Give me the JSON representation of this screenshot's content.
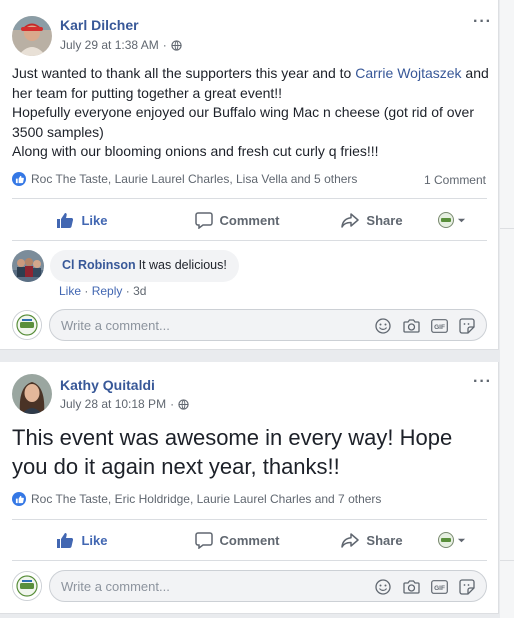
{
  "posts": [
    {
      "author": "Karl Dilcher",
      "timestamp": "July 29 at 1:38 AM",
      "dot": "·",
      "text_parts": {
        "p1": "Just wanted to thank all the supporters this year and to ",
        "mention": "Carrie Wojtaszek",
        "p2": " and her team for putting together a great event!!",
        "line2": "Hopefully everyone enjoyed our Buffalo wing Mac n cheese (got rid of over 3500 samples)",
        "line3": "Along with our blooming onions and fresh cut curly q fries!!!"
      },
      "reactions": "Roc The Taste, Laurie Laurel Charles, Lisa Vella and 5 others",
      "comment_count": "1 Comment",
      "comments": [
        {
          "name": "Cl Robinson",
          "text": "It was delicious!",
          "like": "Like",
          "reply": "Reply",
          "age": "3d"
        }
      ]
    },
    {
      "author": "Kathy Quitaldi",
      "timestamp": "July 28 at 10:18 PM",
      "dot": "·",
      "text": "This event was awesome in every way! Hope you do it again next year, thanks!!",
      "reactions": "Roc The Taste, Eric Holdridge, Laurie Laurel Charles and 7 others"
    }
  ],
  "actions": {
    "like": "Like",
    "comment": "Comment",
    "share": "Share"
  },
  "write_comment": {
    "placeholder": "Write a comment...",
    "gif_label": "GIF"
  },
  "comment_separator": "·",
  "icons": [
    "globe-icon",
    "like-icon",
    "comment-icon",
    "share-icon",
    "audience-icon",
    "emoji-icon",
    "camera-icon",
    "gif-icon",
    "sticker-icon",
    "more-icon"
  ],
  "colors": {
    "link": "#385898",
    "like_blue": "#4267b2",
    "muted": "#606770",
    "bubble": "#f2f3f5"
  }
}
